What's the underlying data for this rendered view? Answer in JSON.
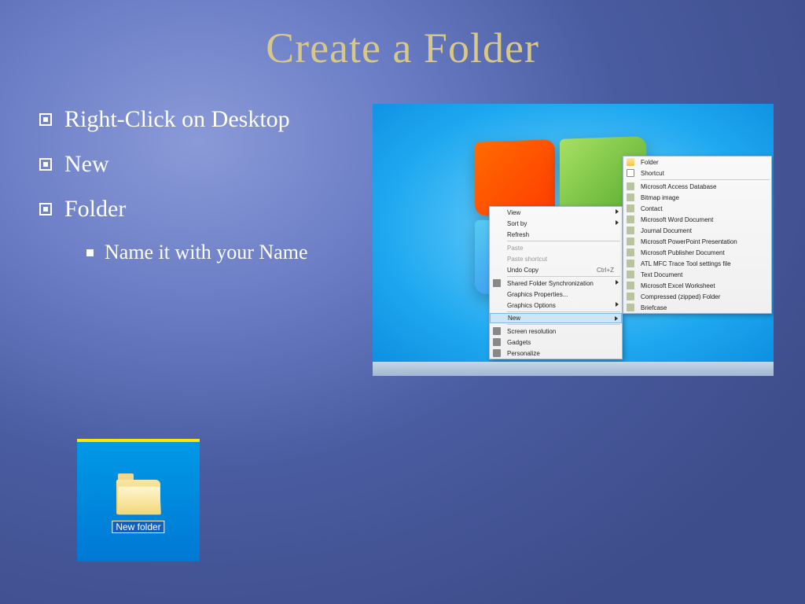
{
  "title": "Create a Folder",
  "bullets": {
    "b1": "Right-Click on Desktop",
    "b2": "New",
    "b3": "Folder",
    "sub1": "Name it with your Name"
  },
  "context_menu_1": {
    "view": "View",
    "sort_by": "Sort by",
    "refresh": "Refresh",
    "paste": "Paste",
    "paste_shortcut": "Paste shortcut",
    "undo_copy": "Undo Copy",
    "undo_copy_shortcut": "Ctrl+Z",
    "shared_folder_sync": "Shared Folder Synchronization",
    "graphics_properties": "Graphics Properties...",
    "graphics_options": "Graphics Options",
    "new": "New",
    "screen_resolution": "Screen resolution",
    "gadgets": "Gadgets",
    "personalize": "Personalize"
  },
  "context_menu_2": {
    "folder": "Folder",
    "shortcut": "Shortcut",
    "access_db": "Microsoft Access Database",
    "bitmap": "Bitmap image",
    "contact": "Contact",
    "word": "Microsoft Word Document",
    "journal": "Journal Document",
    "powerpoint": "Microsoft PowerPoint Presentation",
    "publisher": "Microsoft Publisher Document",
    "atl_mfc": "ATL MFC Trace Tool settings file",
    "text": "Text Document",
    "excel": "Microsoft Excel Worksheet",
    "zip": "Compressed (zipped) Folder",
    "briefcase": "Briefcase"
  },
  "new_folder_label": "New folder"
}
